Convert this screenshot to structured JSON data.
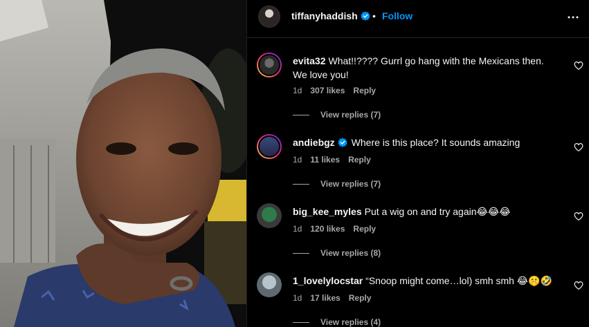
{
  "header": {
    "username": "tiffanyhaddish",
    "separator": "•",
    "follow_label": "Follow"
  },
  "comments": [
    {
      "username": "evita32",
      "verified": false,
      "text": "What!!???? Gurrl go hang with the Mexicans then. We love you!",
      "age": "1d",
      "likes": "307 likes",
      "reply_label": "Reply",
      "view_replies": "View replies (7)"
    },
    {
      "username": "andiebgz",
      "verified": true,
      "text": "Where is this place? It sounds amazing",
      "age": "1d",
      "likes": "11 likes",
      "reply_label": "Reply",
      "view_replies": "View replies (7)"
    },
    {
      "username": "big_kee_myles",
      "verified": false,
      "text": "Put a wig on and try again😂😂😂",
      "age": "1d",
      "likes": "120 likes",
      "reply_label": "Reply",
      "view_replies": "View replies (8)"
    },
    {
      "username": "1_lovelylocstar",
      "verified": false,
      "text": "“Snoop might come…lol) smh smh 😂🤫🤣",
      "age": "1d",
      "likes": "17 likes",
      "reply_label": "Reply",
      "view_replies": "View replies (4)"
    }
  ],
  "colors": {
    "background": "#000000",
    "text": "#f5f5f5",
    "secondary": "#a8a8a8",
    "link": "#0095f6"
  },
  "icons": {
    "verified": "verified-badge-icon",
    "more": "more-options-icon",
    "like": "heart-icon"
  }
}
